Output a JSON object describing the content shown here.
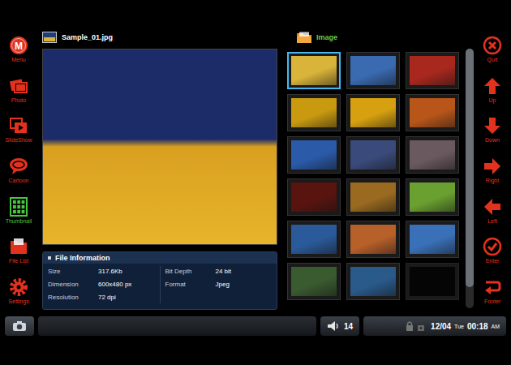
{
  "sidebar_left": {
    "items": [
      {
        "label": "Menu",
        "glyph": "M",
        "selected": false
      },
      {
        "label": "Photo",
        "selected": false
      },
      {
        "label": "SlideShow",
        "selected": false
      },
      {
        "label": "Cartoon",
        "selected": false
      },
      {
        "label": "Thumbnail",
        "selected": true
      },
      {
        "label": "File List",
        "selected": false
      },
      {
        "label": "Settings",
        "selected": false
      }
    ]
  },
  "file": {
    "name": "Sample_01.jpg"
  },
  "file_info": {
    "title": "File Information",
    "columns": [
      [
        {
          "label": "Size",
          "value": "317.6Kb"
        },
        {
          "label": "Dimension",
          "value": "600x480 px"
        },
        {
          "label": "Resolution",
          "value": "72 dpi"
        }
      ],
      [
        {
          "label": "Bit Depth",
          "value": "24 bit"
        },
        {
          "label": "Format",
          "value": "Jpeg"
        }
      ]
    ]
  },
  "folder": {
    "name": "Image"
  },
  "thumbnails": [
    {
      "kind": "photo",
      "selected": true,
      "color": "#d9b43a"
    },
    {
      "kind": "photo",
      "selected": false,
      "color": "#3a6ab0"
    },
    {
      "kind": "photo",
      "selected": false,
      "color": "#a8281e"
    },
    {
      "kind": "photo",
      "selected": false,
      "color": "#c99a10"
    },
    {
      "kind": "photo",
      "selected": false,
      "color": "#d6a010"
    },
    {
      "kind": "photo",
      "selected": false,
      "color": "#b8561a"
    },
    {
      "kind": "photo",
      "selected": false,
      "color": "#2a5aa8"
    },
    {
      "kind": "photo",
      "selected": false,
      "color": "#3a4a7a"
    },
    {
      "kind": "photo",
      "selected": false,
      "color": "#6a5a60"
    },
    {
      "kind": "photo",
      "selected": false,
      "color": "#5a1410"
    },
    {
      "kind": "photo",
      "selected": false,
      "color": "#9a6a20"
    },
    {
      "kind": "photo",
      "selected": false,
      "color": "#6aa030"
    },
    {
      "kind": "photo",
      "selected": false,
      "color": "#2a5a9a"
    },
    {
      "kind": "photo",
      "selected": false,
      "color": "#b8602a"
    },
    {
      "kind": "photo",
      "selected": false,
      "color": "#3a70b8"
    },
    {
      "kind": "photo",
      "selected": false,
      "color": "#3a5a30"
    },
    {
      "kind": "photo",
      "selected": false,
      "color": "#2a5a8a"
    },
    {
      "kind": "empty",
      "selected": false,
      "color": "#050505"
    }
  ],
  "scrollbar": {
    "level": 0.92
  },
  "sidebar_right": {
    "items": [
      {
        "label": "Quit"
      },
      {
        "label": "Up"
      },
      {
        "label": "Down"
      },
      {
        "label": "Right"
      },
      {
        "label": "Left"
      },
      {
        "label": "Enter"
      },
      {
        "label": "Footer"
      }
    ]
  },
  "status_bar": {
    "volume": "14",
    "date": "12/04",
    "weekday": "Tue",
    "time": "00:18",
    "meridiem": "AM"
  }
}
